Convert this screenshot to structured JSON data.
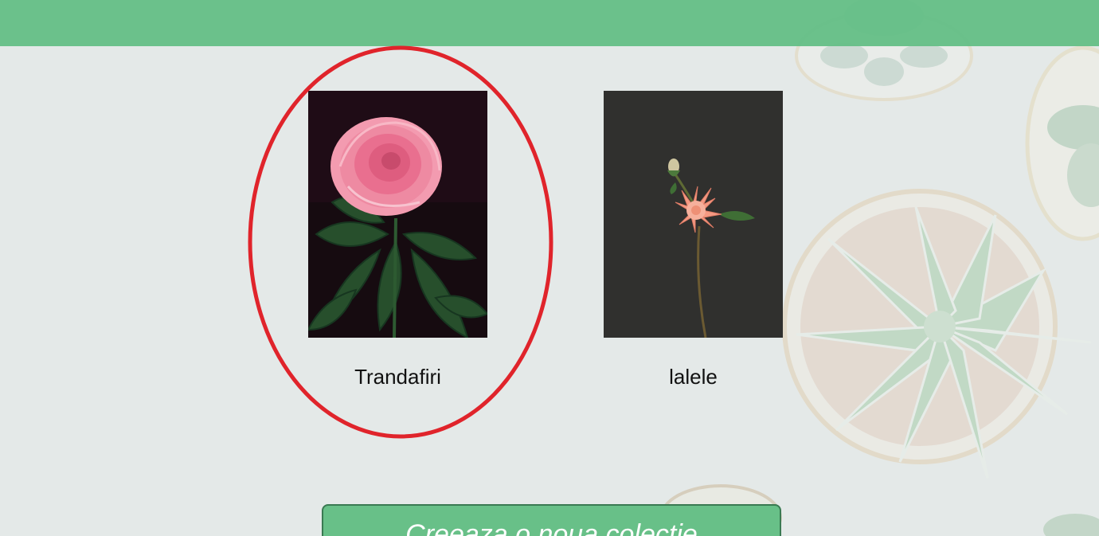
{
  "colors": {
    "header": "#66bf87",
    "background": "#e4e9e8",
    "highlight": "#e0242b",
    "button": "#68c088"
  },
  "collections": [
    {
      "label": "Trandafiri",
      "image": "pink-rose-photo"
    },
    {
      "label": "lalele",
      "image": "peach-dahlia-photo"
    }
  ],
  "actions": {
    "create_label": "Creeaza o noua colectie"
  }
}
